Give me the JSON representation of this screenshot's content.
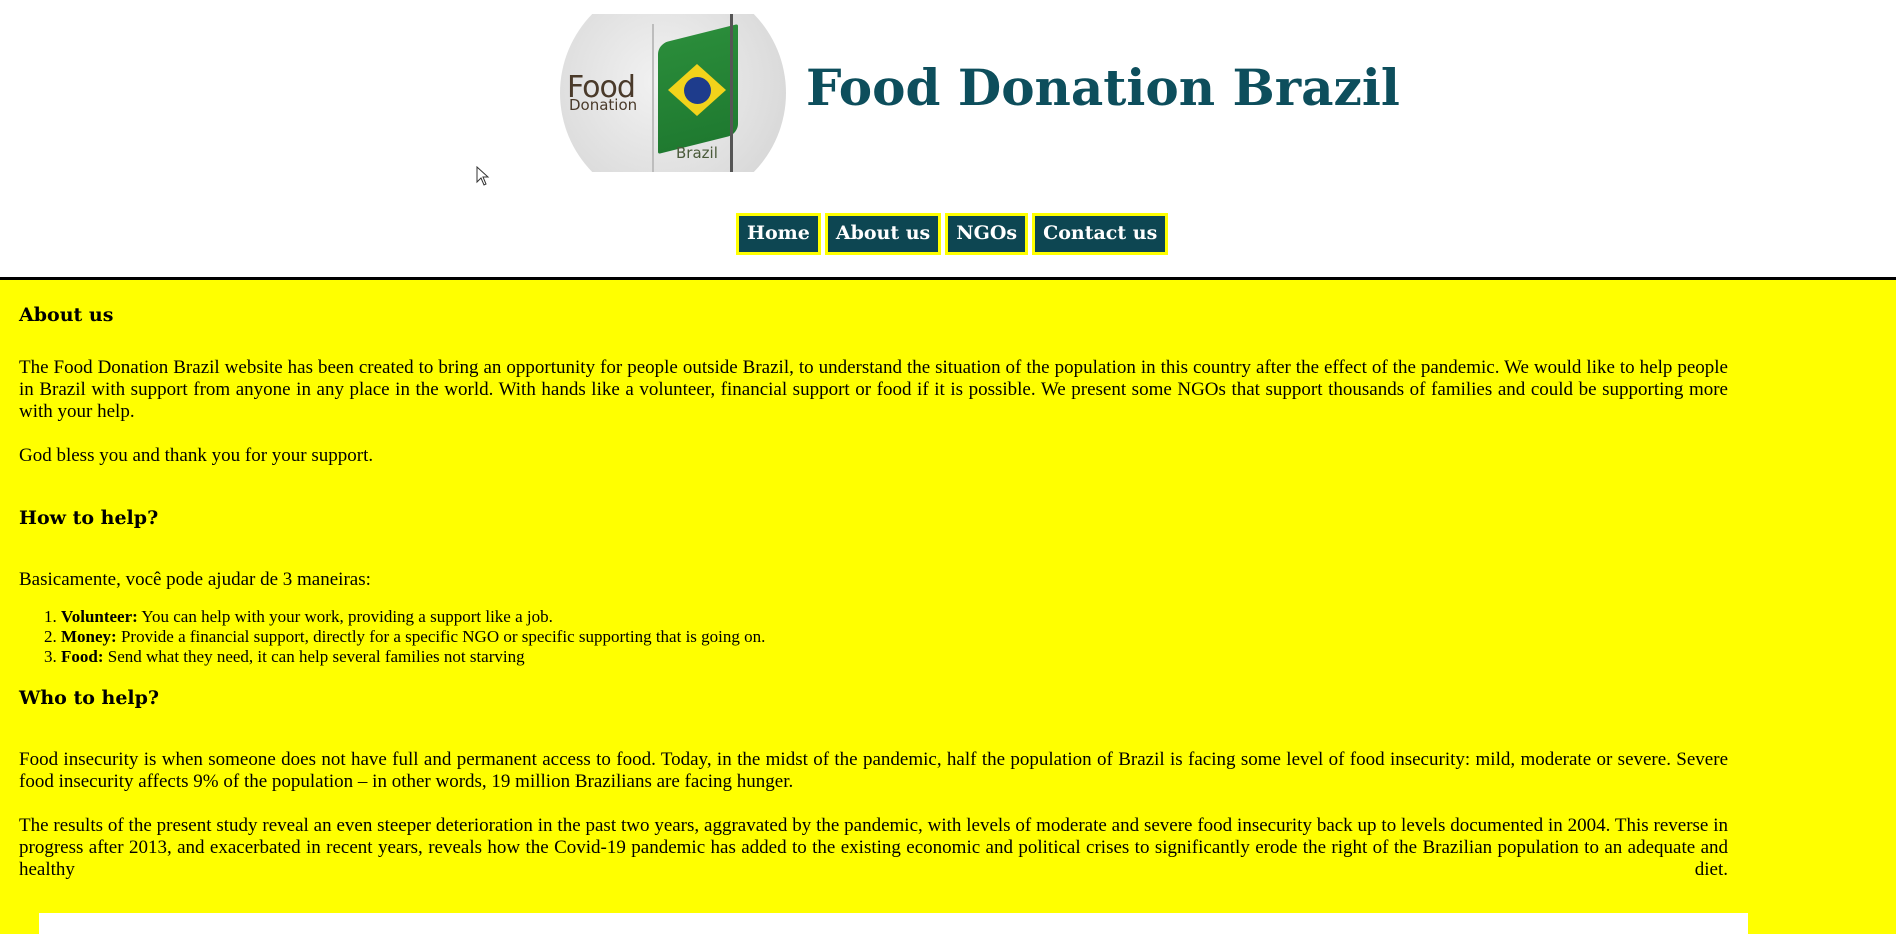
{
  "header": {
    "logo": {
      "text_food": "Food",
      "text_donation": "Donation",
      "text_brazil": "Brazil"
    },
    "site_title": "Food Donation Brazil",
    "nav": [
      {
        "label": "Home"
      },
      {
        "label": "About us"
      },
      {
        "label": "NGOs"
      },
      {
        "label": "Contact us"
      }
    ]
  },
  "colors": {
    "title": "#0d4e5c",
    "nav_bg": "#0d4652",
    "nav_border": "#ffff00",
    "content_bg": "#ffff00"
  },
  "about": {
    "heading": "About us",
    "paragraph_1": "The Food Donation Brazil website has been created to bring an opportunity for people outside Brazil, to understand the situation of the population in this country after the effect of the pandemic. We would like to help people in Brazil with support from anyone in any place in the world. With hands like a volunteer, financial support or food if it is possible. We present some NGOs that support thousands of families and could be supporting more with your help.",
    "paragraph_2": "God bless you and thank you for your support."
  },
  "how_to_help": {
    "heading": "How to help?",
    "intro": "Basicamente, você pode ajudar de 3 maneiras:",
    "items": [
      {
        "label": "Volunteer:",
        "text": " You can help with your work, providing a support like a job."
      },
      {
        "label": "Money:",
        "text": " Provide a financial support, directly for a specific NGO or specific supporting that is going on."
      },
      {
        "label": "Food:",
        "text": " Send what they need, it can help several families not starving"
      }
    ]
  },
  "who_to_help": {
    "heading": "Who to help?",
    "paragraph_1": "Food insecurity is when someone does not have full and permanent access to food. Today, in the midst of the pandemic, half the population of Brazil is facing some level of food insecurity: mild, moderate or severe. Severe food insecurity affects 9% of the population – in other words, 19 million Brazilians are facing hunger.",
    "paragraph_2": "The results of the present study reveal an even steeper deterioration in the past two years, aggravated by the pandemic, with levels of moderate and severe food insecurity back up to levels documented in 2004. This reverse in progress after 2013, and exacerbated in recent years, reveals how the Covid-19 pandemic has added to the existing economic and political crises to significantly erode the right of the Brazilian population to an adequate and healthy diet."
  }
}
